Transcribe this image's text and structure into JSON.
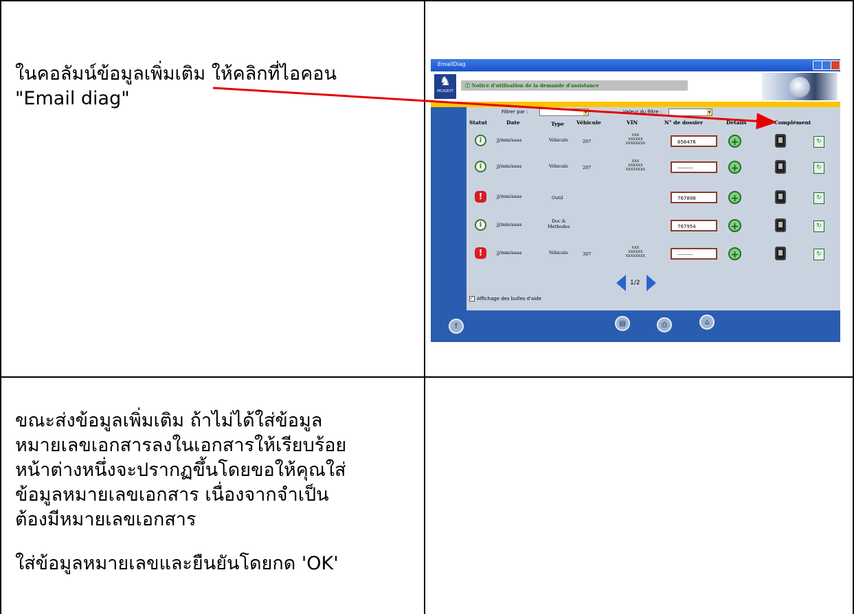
{
  "doc": {
    "cell1_text": "ในคอลัมน์ข้อมูลเพิ่มเติม ให้คลิกที่ไอคอน\n\"Email diag\"",
    "cell3_text": "ขณะส่งข้อมูลเพิ่มเติม ถ้าไม่ได้ใส่ข้อมูล\nหมายเลขเอกสารลงในเอกสารให้เรียบร้อย\nหน้าต่างหนึ่งจะปรากฏขึ้นโดยขอให้คุณใส่\nข้อมูลหมายเลขเอกสาร เนื่องจากจำเป็น\nต้องมีหมายเลขเอกสาร",
    "cell3_text_2": "ใส่ข้อมูลหมายเลขและยืนยันโดยกด 'OK'"
  },
  "screenshot": {
    "window_title": "EmailDiag",
    "logo_text": "PEUGEOT",
    "notice_text": "Notice d'utilisation de la demande d'assistance",
    "filter_label": "Filtrer par :",
    "filter_value_label": "Valeur du filtre :",
    "columns": [
      "Statut",
      "Date",
      "Type",
      "Véhicule",
      "VIN",
      "N° de dossier",
      "Détails",
      "Complément"
    ],
    "rows": [
      {
        "status": "info",
        "date": "jj/mm/aaaa",
        "type": "Véhicule",
        "vehicle": "207",
        "vin": "XXX\nXXXXXX\nXXXXXXXX",
        "dossier": "656476"
      },
      {
        "status": "info",
        "date": "jj/mm/aaaa",
        "type": "Véhicule",
        "vehicle": "207",
        "vin": "XXX\nXXXXXX\nXXXXXXXX",
        "dossier": "---------"
      },
      {
        "status": "warning",
        "date": "jj/mm/aaaa",
        "type": "Outil",
        "vehicle": "",
        "vin": "",
        "dossier": "767898"
      },
      {
        "status": "info",
        "date": "jj/mm/aaaa",
        "type": "Doc &\nMethodes",
        "vehicle": "",
        "vin": "",
        "dossier": "767954"
      },
      {
        "status": "warning",
        "date": "jj/mm/aaaa",
        "type": "Véhicule",
        "vehicle": "307",
        "vin": "XXX\nXXXXXX\nXXXXXXXX",
        "dossier": "---------"
      }
    ],
    "page_indicator": "1/2",
    "help_checkbox_label": "Affichage des bulles d'aide",
    "accent_color": "#2a5db0",
    "arrow_color": "#e60000"
  }
}
